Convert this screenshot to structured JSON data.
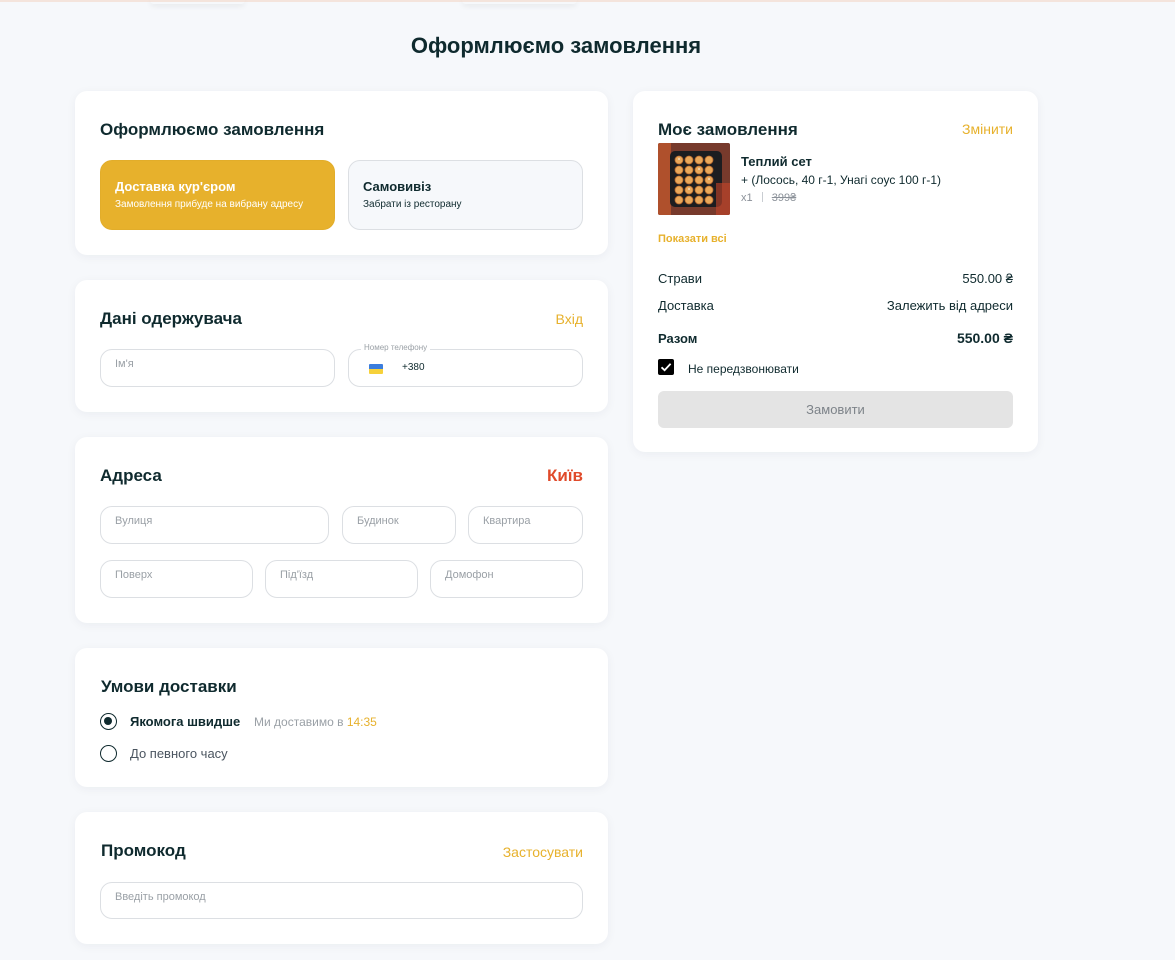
{
  "page": {
    "title": "Оформлюємо замовлення"
  },
  "delivery_type": {
    "title": "Оформлюємо замовлення",
    "options": [
      {
        "title": "Доставка кур'єром",
        "subtitle": "Замовлення прибуде на вибрану адресу",
        "selected": true
      },
      {
        "title": "Самовивіз",
        "subtitle": "Забрати із ресторану",
        "selected": false
      }
    ]
  },
  "recipient": {
    "title": "Дані одержувача",
    "login_link": "Вхід",
    "name_placeholder": "Ім'я",
    "phone_label": "Номер телефону",
    "phone_prefix": "+380"
  },
  "address": {
    "title": "Адреса",
    "city": "Київ",
    "street_placeholder": "Вулиця",
    "house_placeholder": "Будинок",
    "apartment_placeholder": "Квартира",
    "floor_placeholder": "Поверх",
    "entrance_placeholder": "Під'їзд",
    "intercom_placeholder": "Домофон"
  },
  "delivery_terms": {
    "title": "Умови доставки",
    "asap_label": "Якомога швидше",
    "asap_note": "Ми доставимо в",
    "asap_time": "14:35",
    "scheduled_label": "До певного часу",
    "selected": "asap"
  },
  "promo": {
    "title": "Промокод",
    "apply_link": "Застосувати",
    "placeholder": "Введіть промокод"
  },
  "order": {
    "title": "Моє замовлення",
    "edit_link": "Змінити",
    "item": {
      "name": "Теплий сет",
      "options": "+ (Лосось, 40 г-1, Унагі соус 100 г-1)",
      "quantity": "x1",
      "price": "399₴"
    },
    "show_all": "Показати всі",
    "dishes_label": "Страви",
    "dishes_value": "550.00 ₴",
    "delivery_label": "Доставка",
    "delivery_value": "Залежить від адреси",
    "total_label": "Разом",
    "total_value": "550.00 ₴",
    "no_call_label": "Не передзвонювати",
    "no_call_checked": true,
    "submit_label": "Замовити"
  },
  "colors": {
    "accent": "#e7b12c",
    "city": "#e04a2a",
    "text": "#0f2a2e",
    "disabled_button": "#e4e4e4"
  }
}
